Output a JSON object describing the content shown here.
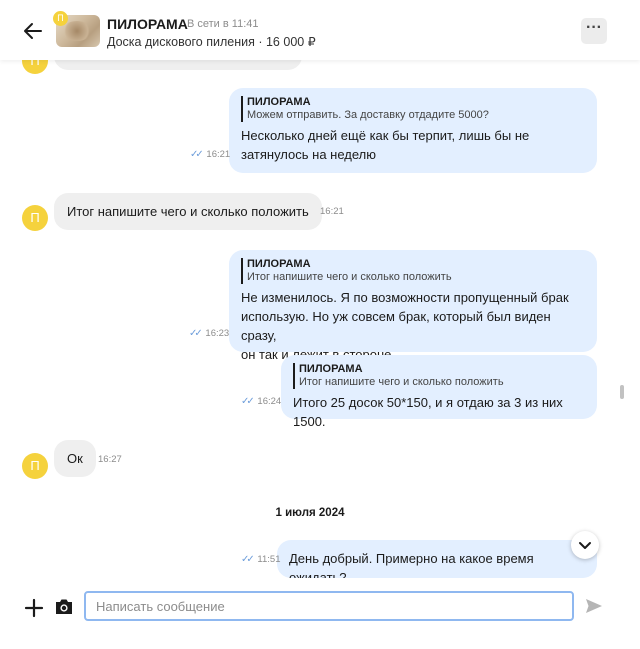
{
  "header": {
    "title": "ПИЛОРАМА",
    "status": "В сети в 11:41",
    "subtitle": "Доска дискового пиления · 16 000 ₽",
    "thumb_avatar_letter": "П",
    "back_icon": "arrow-left-icon",
    "more_icon": "more-dots-icon",
    "more_label": "···"
  },
  "avatar_letter": "П",
  "messages": [
    {
      "quote_author": "ПИЛОРАМА",
      "quote_text": "Можем отправить. За доставку отдадите 5000?",
      "lines": [
        "Несколько дней ещё как бы терпит, лишь бы не",
        "затянулось на неделю"
      ],
      "time": "16:21"
    },
    {
      "text": "Итог напишите чего и сколько положить",
      "time": "16:21"
    },
    {
      "quote_author": "ПИЛОРАМА",
      "quote_text": "Итог напишите чего и сколько положить",
      "lines": [
        "Не изменилось. Я по возможности пропущенный брак",
        "использую. Но уж совсем брак, который был виден сразу,",
        "он так и лежит в стороне"
      ],
      "time": "16:23"
    },
    {
      "quote_author": "ПИЛОРАМА",
      "quote_text": "Итог напишите чего и сколько положить",
      "text": "Итого 25 досок 50*150, и я отдаю за 3 из них 1500.",
      "time": "16:24"
    },
    {
      "text": "Ок",
      "time": "16:27"
    },
    {
      "text": "День добрый. Примерно на какое время ожидать?",
      "time": "11:51"
    }
  ],
  "date_separator": "1 июля 2024",
  "read_ticks": "✓✓",
  "composer": {
    "placeholder": "Написать сообщение",
    "plus_icon": "plus-icon",
    "camera_icon": "camera-icon",
    "send_icon": "send-icon"
  },
  "colors": {
    "outgoing_bubble": "#e3efff",
    "incoming_bubble": "#efefef",
    "avatar": "#f5d23d",
    "ticks": "#6e9edb"
  }
}
